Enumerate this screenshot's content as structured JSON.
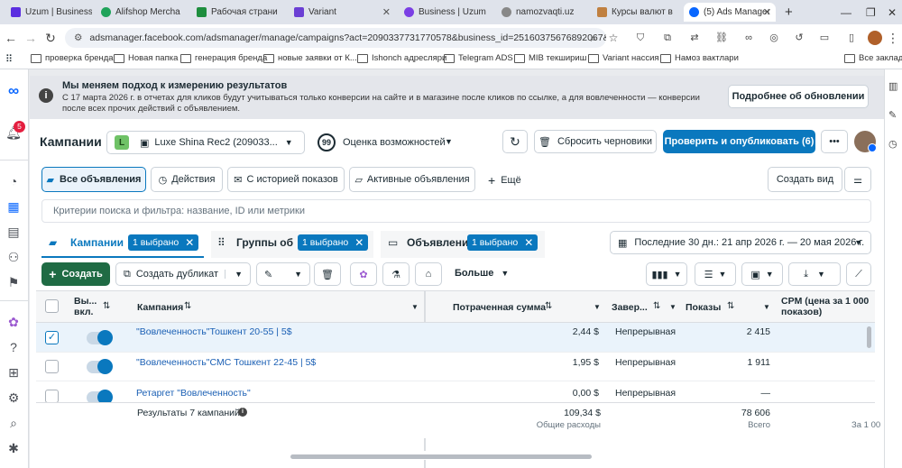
{
  "browser": {
    "tabs": [
      {
        "title": "Uzum | Business",
        "color": "#5b2ee0"
      },
      {
        "title": "Alifshop Mercha",
        "color": "#20a35a"
      },
      {
        "title": "Рабочая страни",
        "color": "#1e8e3e"
      },
      {
        "title": "Variant",
        "color": "#6b3fd4"
      },
      {
        "title": "Business | Uzum",
        "color": "#7b3fe4"
      },
      {
        "title": "namozvaqti.uz",
        "color": "#888888"
      },
      {
        "title": "Курсы валют в",
        "color": "#c08040"
      },
      {
        "title": "(5) Ads Manager",
        "color": "#0866ff"
      }
    ],
    "url": "adsmanager.facebook.com/adsmanager/manage/campaigns?act=2090337731770578&business_id=25160375676892067&gl...",
    "bookmarks": [
      "проверка бренда",
      "Новая папка",
      "генерация бренда",
      "новые заявки от К...",
      "Ishonch адресляри",
      "Telegram ADS",
      "MIB текшириш",
      "Variant нассия",
      "Намоз вактлари",
      "Все закладк"
    ]
  },
  "leftnav": {
    "notification_count": "5"
  },
  "banner": {
    "title": "Мы меняем подход к измерению результатов",
    "text": "С 17 марта 2026 г. в отчетах для кликов будут учитываться только конверсии на сайте и в магазине после кликов по ссылке, а для вовлеченности — конверсии после всех прочих действий с объявлением.",
    "button": "Подробнее об обновлении"
  },
  "header": {
    "title": "Кампании",
    "account_initial": "L",
    "account_name": "Luxe Shina Rec2 (209033...",
    "score": "99",
    "score_label": "Оценка возможностей",
    "discard_label": "Сбросить черновики",
    "publish_label": "Проверить и опубликовать (6)"
  },
  "views": {
    "all_ads": "Все объявления",
    "actions": "Действия",
    "with_history": "С историей показов",
    "active_ads": "Активные объявления",
    "more": "Ещё",
    "create_view": "Создать вид"
  },
  "search": {
    "placeholder": "Критерии поиска и фильтра: название, ID или метрики"
  },
  "levels": {
    "campaigns": "Кампании",
    "adsets": "Группы об",
    "ads": "Объявлени",
    "selected": "1 выбрано",
    "date_range": "Последние 30 дн.: 21 апр 2026 г. — 20 мая 2026 г."
  },
  "toolbar": {
    "create": "Создать",
    "duplicate": "Создать дубликат",
    "more": "Больше"
  },
  "table": {
    "headers": {
      "toggle": "Вы... вкл.",
      "campaign": "Кампания",
      "spent": "Потраченная сумма",
      "ends": "Завер...",
      "impressions": "Показы",
      "cpm": "CPM (цена за 1 000 показов)"
    },
    "rows": [
      {
        "name": "\"Вовлеченность\"Тошкент 20-55 | 5$",
        "spent": "2,44 $",
        "ends": "Непрерывная",
        "impressions": "2 415",
        "checked": true
      },
      {
        "name": "\"Вовлеченность\"СМС Тошкент 22-45 | 5$",
        "spent": "1,95 $",
        "ends": "Непрерывная",
        "impressions": "1 911",
        "checked": false
      },
      {
        "name": "Ретаргет \"Вовлеченность\"",
        "spent": "0,00 $",
        "ends": "Непрерывная",
        "impressions": "—",
        "checked": false
      }
    ],
    "totals": {
      "label": "Результаты 7 кампаний",
      "spent": "109,34 $",
      "spent_sub": "Общие расходы",
      "impressions": "78 606",
      "impressions_sub": "Всего",
      "cpm_sub": "За 1 00"
    }
  }
}
